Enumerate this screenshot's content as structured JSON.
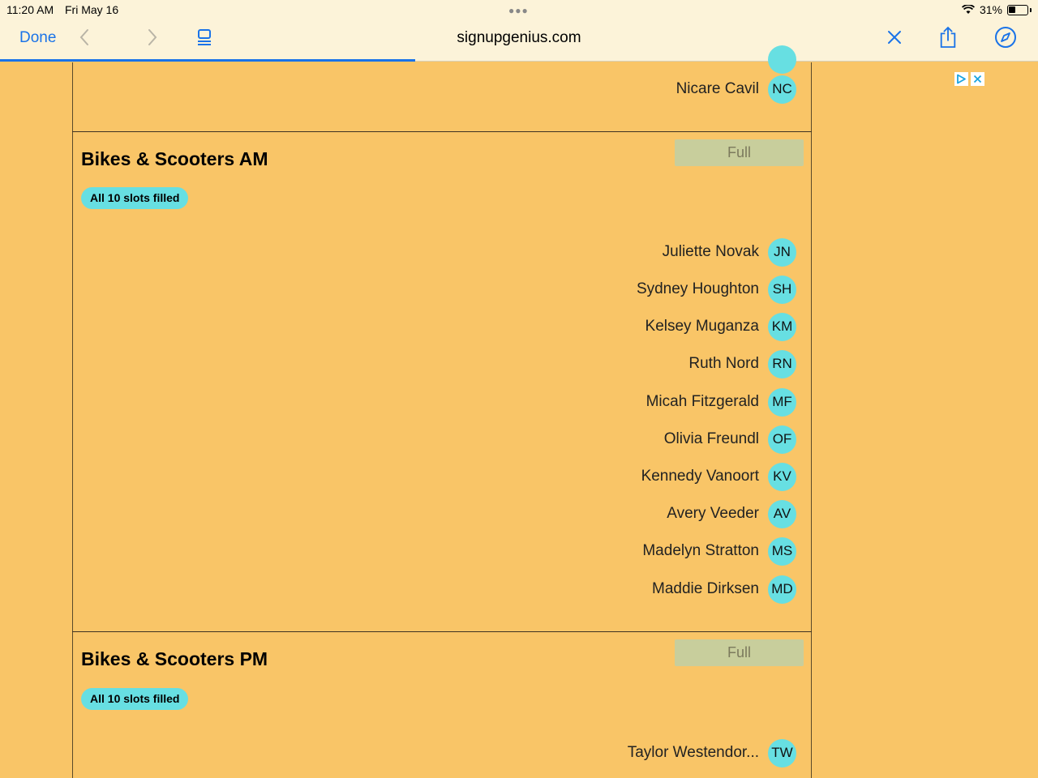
{
  "status": {
    "time": "11:20 AM",
    "date": "Fri May 16",
    "battery": "31%"
  },
  "browser": {
    "done_label": "Done",
    "url": "signupgenius.com"
  },
  "top_person": {
    "name": "Nicare Cavil",
    "initials": "NC"
  },
  "slots": [
    {
      "title": "Bikes & Scooters AM",
      "badge": "All 10 slots filled",
      "button": "Full",
      "people": [
        {
          "name": "Juliette Novak",
          "initials": "JN"
        },
        {
          "name": "Sydney Houghton",
          "initials": "SH"
        },
        {
          "name": "Kelsey Muganza",
          "initials": "KM"
        },
        {
          "name": "Ruth Nord",
          "initials": "RN"
        },
        {
          "name": "Micah Fitzgerald",
          "initials": "MF"
        },
        {
          "name": "Olivia Freundl",
          "initials": "OF"
        },
        {
          "name": "Kennedy Vanoort",
          "initials": "KV"
        },
        {
          "name": "Avery Veeder",
          "initials": "AV"
        },
        {
          "name": "Madelyn Stratton",
          "initials": "MS"
        },
        {
          "name": "Maddie Dirksen",
          "initials": "MD"
        }
      ]
    },
    {
      "title": "Bikes & Scooters PM",
      "badge": "All 10 slots filled",
      "button": "Full",
      "people": [
        {
          "name": "Taylor Westendor...",
          "initials": "TW"
        }
      ]
    }
  ],
  "colors": {
    "page_bg": "#f9c567",
    "accent": "#1a73e8",
    "avatar": "#67dfe2",
    "full_button": "#c8ce9c"
  },
  "icons": [
    "back-chevron-icon",
    "forward-chevron-icon",
    "reader-icon",
    "close-icon",
    "share-icon",
    "compass-icon",
    "wifi-icon",
    "battery-icon",
    "ad-choices-icon",
    "ad-close-icon"
  ]
}
